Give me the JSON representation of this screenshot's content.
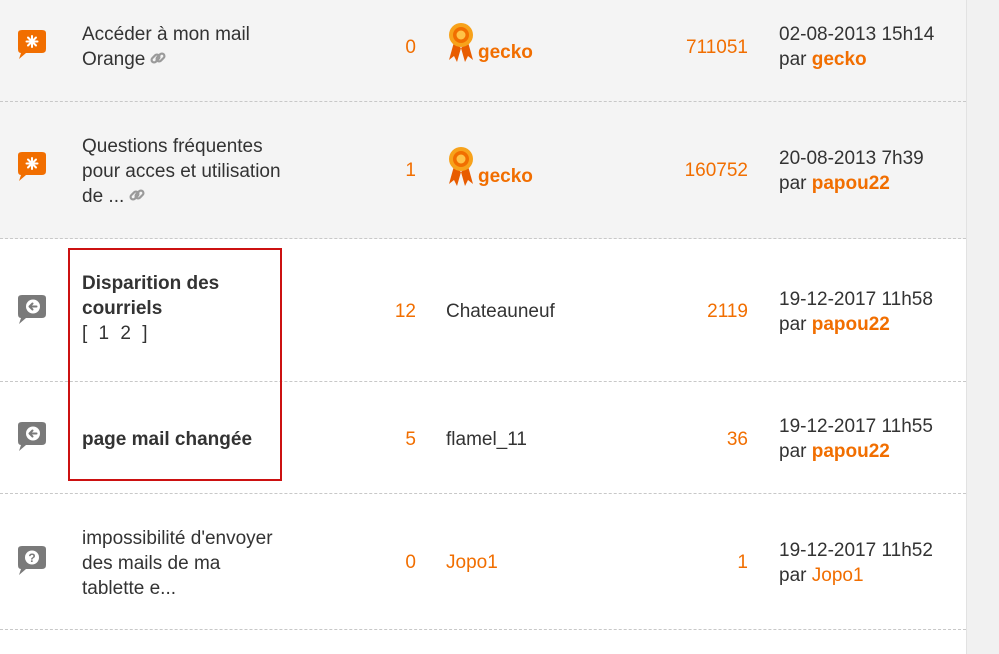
{
  "colors": {
    "accent": "#f16e00",
    "highlight": "#cc1111",
    "text": "#333333"
  },
  "rows": [
    {
      "icon": "orange-star-bubble-icon",
      "subject_lines": [
        "Accéder à mon mail",
        "Orange"
      ],
      "replies": "0",
      "author": "gecko",
      "views": "711051",
      "last_date": "02-08-2013 15h14",
      "last_prefix": "par",
      "last_by": "gecko"
    },
    {
      "icon": "orange-star-bubble-icon",
      "subject_lines": [
        "Questions fréquentes",
        "pour acces et utilisation",
        "de ..."
      ],
      "replies": "1",
      "author": "gecko",
      "views": "160752",
      "last_date": "20-08-2013 7h39",
      "last_prefix": "par",
      "last_by": "papou22"
    },
    {
      "icon": "grey-arrow-bubble-icon",
      "subject_lines": [
        "Disparition des",
        "courriels"
      ],
      "pages": "[ 1 2 ]",
      "replies": "12",
      "author": "Chateauneuf",
      "views": "2119",
      "last_date": "19-12-2017 11h58",
      "last_prefix": "par",
      "last_by": "papou22"
    },
    {
      "icon": "grey-arrow-bubble-icon",
      "subject_lines": [
        "page mail changée"
      ],
      "replies": "5",
      "author": "flamel_11",
      "views": "36",
      "last_date": "19-12-2017 11h55",
      "last_prefix": "par",
      "last_by": "papou22"
    },
    {
      "icon": "grey-question-bubble-icon",
      "subject_lines": [
        "impossibilité d'envoyer",
        "des mails de ma",
        "tablette e..."
      ],
      "replies": "0",
      "author": "Jopo1",
      "views": "1",
      "last_date": "19-12-2017 11h52",
      "last_prefix": "par",
      "last_by": "Jopo1"
    }
  ]
}
